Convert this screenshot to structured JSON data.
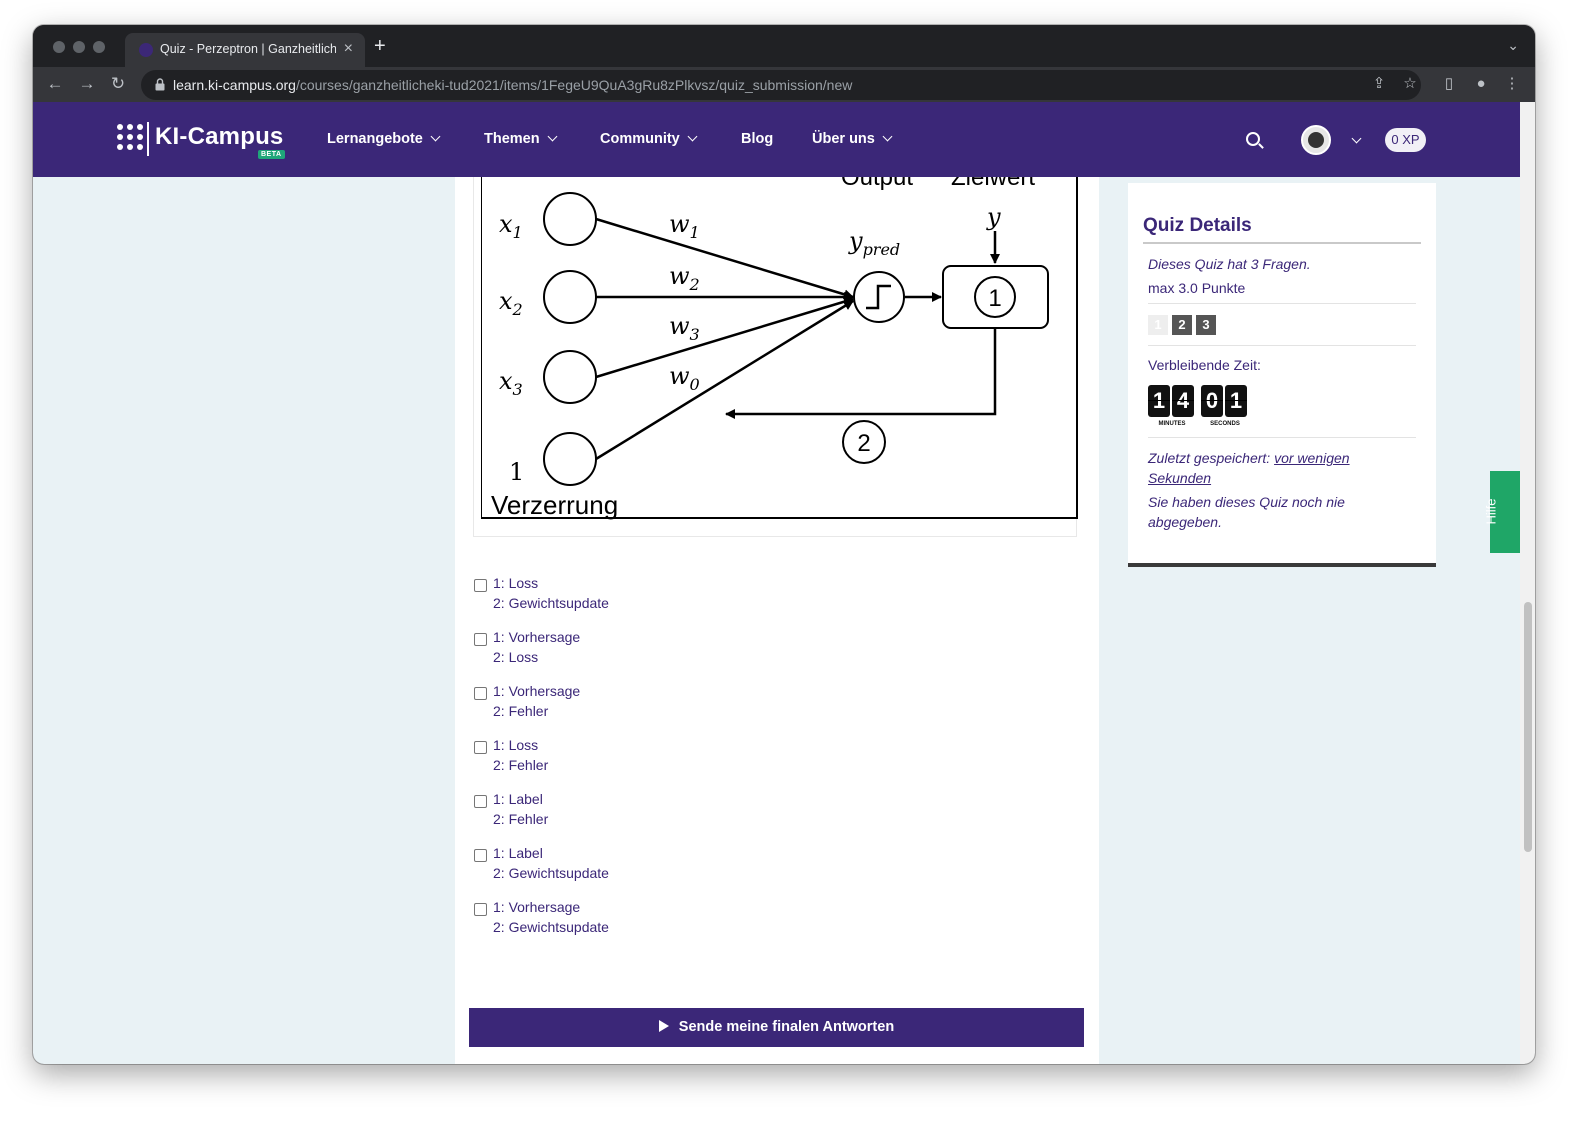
{
  "browser": {
    "tab_title": "Quiz - Perzeptron | Ganzheitliche",
    "url_host": "learn.ki-campus.org",
    "url_path": "/courses/ganzheitlicheki-tud2021/items/1FegeU9QuA3gRu8zPlkvsz/quiz_submission/new"
  },
  "header": {
    "logo_text": "KI-Campus",
    "beta_label": "BETA",
    "nav": [
      "Lernangebote",
      "Themen",
      "Community",
      "Blog",
      "Über uns"
    ],
    "xp_label": "0 XP"
  },
  "diagram": {
    "labels": {
      "output": "Output",
      "zielwert": "Zielwert",
      "y": "y",
      "y_pred": "y",
      "y_pred_sub": "pred",
      "x1": "x",
      "x1_sub": "1",
      "x2": "x",
      "x2_sub": "2",
      "x3": "x",
      "x3_sub": "3",
      "bias_one": "1",
      "w1": "w",
      "w1_sub": "1",
      "w2": "w",
      "w2_sub": "2",
      "w3": "w",
      "w3_sub": "3",
      "w0": "w",
      "w0_sub": "0",
      "marker1": "1",
      "marker2": "2",
      "bias_label": "Verzerrung"
    }
  },
  "options": [
    {
      "line1": "1: Loss",
      "line2": "2: Gewichtsupdate"
    },
    {
      "line1": "1: Vorhersage",
      "line2": "2: Loss"
    },
    {
      "line1": "1: Vorhersage",
      "line2": "2: Fehler"
    },
    {
      "line1": "1: Loss",
      "line2": "2: Fehler"
    },
    {
      "line1": "1: Label",
      "line2": "2: Fehler"
    },
    {
      "line1": "1: Label",
      "line2": "2: Gewichtsupdate"
    },
    {
      "line1": "1: Vorhersage",
      "line2": "2: Gewichtsupdate"
    }
  ],
  "submit_label": "Sende meine finalen Antworten",
  "sidebar": {
    "title": "Quiz Details",
    "question_count_text": "Dieses Quiz hat 3 Fragen.",
    "max_points_text": "max 3.0 Punkte",
    "questions": [
      "1",
      "2",
      "3"
    ],
    "remaining_label": "Verbleibende Zeit:",
    "timer": {
      "min1": "1",
      "min2": "4",
      "sec1": "0",
      "sec2": "1",
      "minutes_label": "MINUTES",
      "seconds_label": "SECONDS"
    },
    "last_saved_label": "Zuletzt gespeichert:",
    "last_saved_link1": "vor wenigen",
    "last_saved_link2": "Sekunden",
    "not_submitted_line1": "Sie haben dieses Quiz noch nie",
    "not_submitted_line2": "abgegeben."
  },
  "help_label": "Hilfe"
}
